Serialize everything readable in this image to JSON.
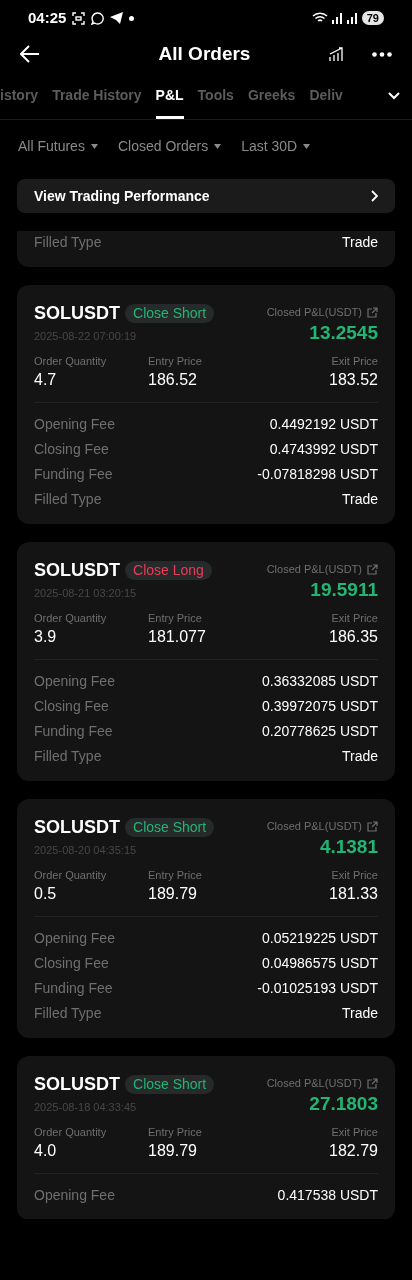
{
  "status_bar": {
    "time": "04:25",
    "battery": "79"
  },
  "header": {
    "title": "All Orders"
  },
  "tabs": [
    {
      "label": "istory",
      "selected": false
    },
    {
      "label": "Trade History",
      "selected": false
    },
    {
      "label": "P&L",
      "selected": true
    },
    {
      "label": "Tools",
      "selected": false
    },
    {
      "label": "Greeks",
      "selected": false
    },
    {
      "label": "Deliv",
      "selected": false
    }
  ],
  "filters": [
    "All Futures",
    "Closed Orders",
    "Last 30D"
  ],
  "performance_link": "View Trading Performance",
  "partial_card": {
    "rows": [
      {
        "label": "Filled Type",
        "value": "Trade"
      }
    ]
  },
  "orders": [
    {
      "symbol": "SOLUSDT",
      "side": "Close Short",
      "kind": "short",
      "time": "2025-08-22 07:00:19",
      "pnl_label": "Closed P&L(USDT)",
      "pnl": "13.2545",
      "stats": [
        {
          "label": "Order Quantity",
          "value": "4.7"
        },
        {
          "label": "Entry Price",
          "value": "186.52"
        },
        {
          "label": "Exit Price",
          "value": "183.52"
        }
      ],
      "rows": [
        {
          "label": "Opening Fee",
          "value": "0.4492192 USDT"
        },
        {
          "label": "Closing Fee",
          "value": "0.4743992 USDT"
        },
        {
          "label": "Funding Fee",
          "value": "-0.07818298 USDT"
        },
        {
          "label": "Filled Type",
          "value": "Trade"
        }
      ]
    },
    {
      "symbol": "SOLUSDT",
      "side": "Close Long",
      "kind": "long",
      "time": "2025-08-21 03:20:15",
      "pnl_label": "Closed P&L(USDT)",
      "pnl": "19.5911",
      "stats": [
        {
          "label": "Order Quantity",
          "value": "3.9"
        },
        {
          "label": "Entry Price",
          "value": "181.077"
        },
        {
          "label": "Exit Price",
          "value": "186.35"
        }
      ],
      "rows": [
        {
          "label": "Opening Fee",
          "value": "0.36332085 USDT"
        },
        {
          "label": "Closing Fee",
          "value": "0.39972075 USDT"
        },
        {
          "label": "Funding Fee",
          "value": "0.20778625 USDT"
        },
        {
          "label": "Filled Type",
          "value": "Trade"
        }
      ]
    },
    {
      "symbol": "SOLUSDT",
      "side": "Close Short",
      "kind": "short",
      "time": "2025-08-20 04:35:15",
      "pnl_label": "Closed P&L(USDT)",
      "pnl": "4.1381",
      "stats": [
        {
          "label": "Order Quantity",
          "value": "0.5"
        },
        {
          "label": "Entry Price",
          "value": "189.79"
        },
        {
          "label": "Exit Price",
          "value": "181.33"
        }
      ],
      "rows": [
        {
          "label": "Opening Fee",
          "value": "0.05219225 USDT"
        },
        {
          "label": "Closing Fee",
          "value": "0.04986575 USDT"
        },
        {
          "label": "Funding Fee",
          "value": "-0.01025193 USDT"
        },
        {
          "label": "Filled Type",
          "value": "Trade"
        }
      ]
    },
    {
      "symbol": "SOLUSDT",
      "side": "Close Short",
      "kind": "short",
      "time": "2025-08-18 04:33:45",
      "pnl_label": "Closed P&L(USDT)",
      "pnl": "27.1803",
      "stats": [
        {
          "label": "Order Quantity",
          "value": "4.0"
        },
        {
          "label": "Entry Price",
          "value": "189.79"
        },
        {
          "label": "Exit Price",
          "value": "182.79"
        }
      ],
      "rows": [
        {
          "label": "Opening Fee",
          "value": "0.417538 USDT"
        }
      ]
    }
  ]
}
